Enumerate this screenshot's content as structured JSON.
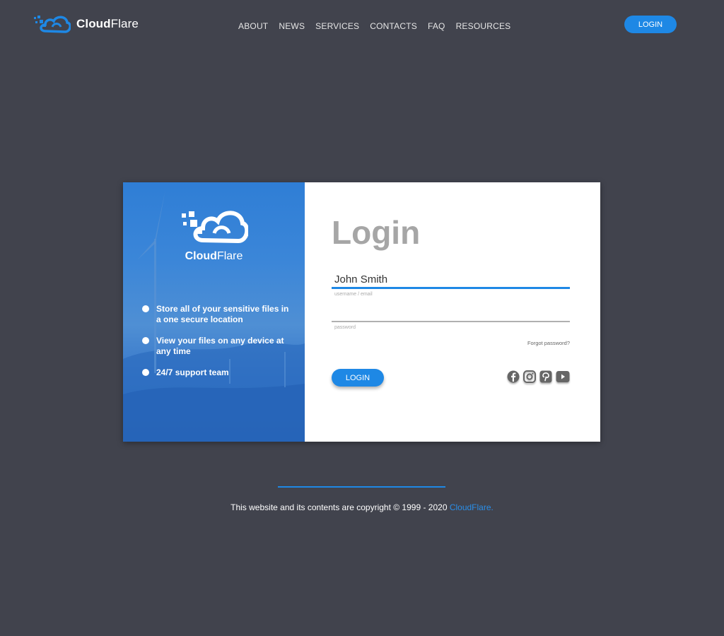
{
  "header": {
    "logo_bold": "Cloud",
    "logo_light": "Flare",
    "nav": [
      "ABOUT",
      "NEWS",
      "SERVICES",
      "CONTACTS",
      "FAQ",
      "RESOURCES"
    ],
    "login_button": "LOGIN"
  },
  "card": {
    "brand_bold": "Cloud",
    "brand_light": "Flare",
    "features": [
      "Store all of your sensitive files in a one secure location",
      "View your files on any device at any time",
      "24/7 support team"
    ],
    "title": "Login",
    "username": {
      "value": "John Smith",
      "hint": "username / email"
    },
    "password": {
      "value": "",
      "hint": "password"
    },
    "forgot": "Forgot password?",
    "login_button": "LOGIN",
    "social_icons": [
      "facebook-icon",
      "instagram-icon",
      "pinterest-icon",
      "youtube-icon"
    ]
  },
  "footer": {
    "text": "This website and its contents are copyright © 1999 - 2020 ",
    "link": "CloudFlare."
  },
  "colors": {
    "background": "#41434d",
    "accent": "#1e88e5",
    "title_gray": "#a6a6a6"
  }
}
